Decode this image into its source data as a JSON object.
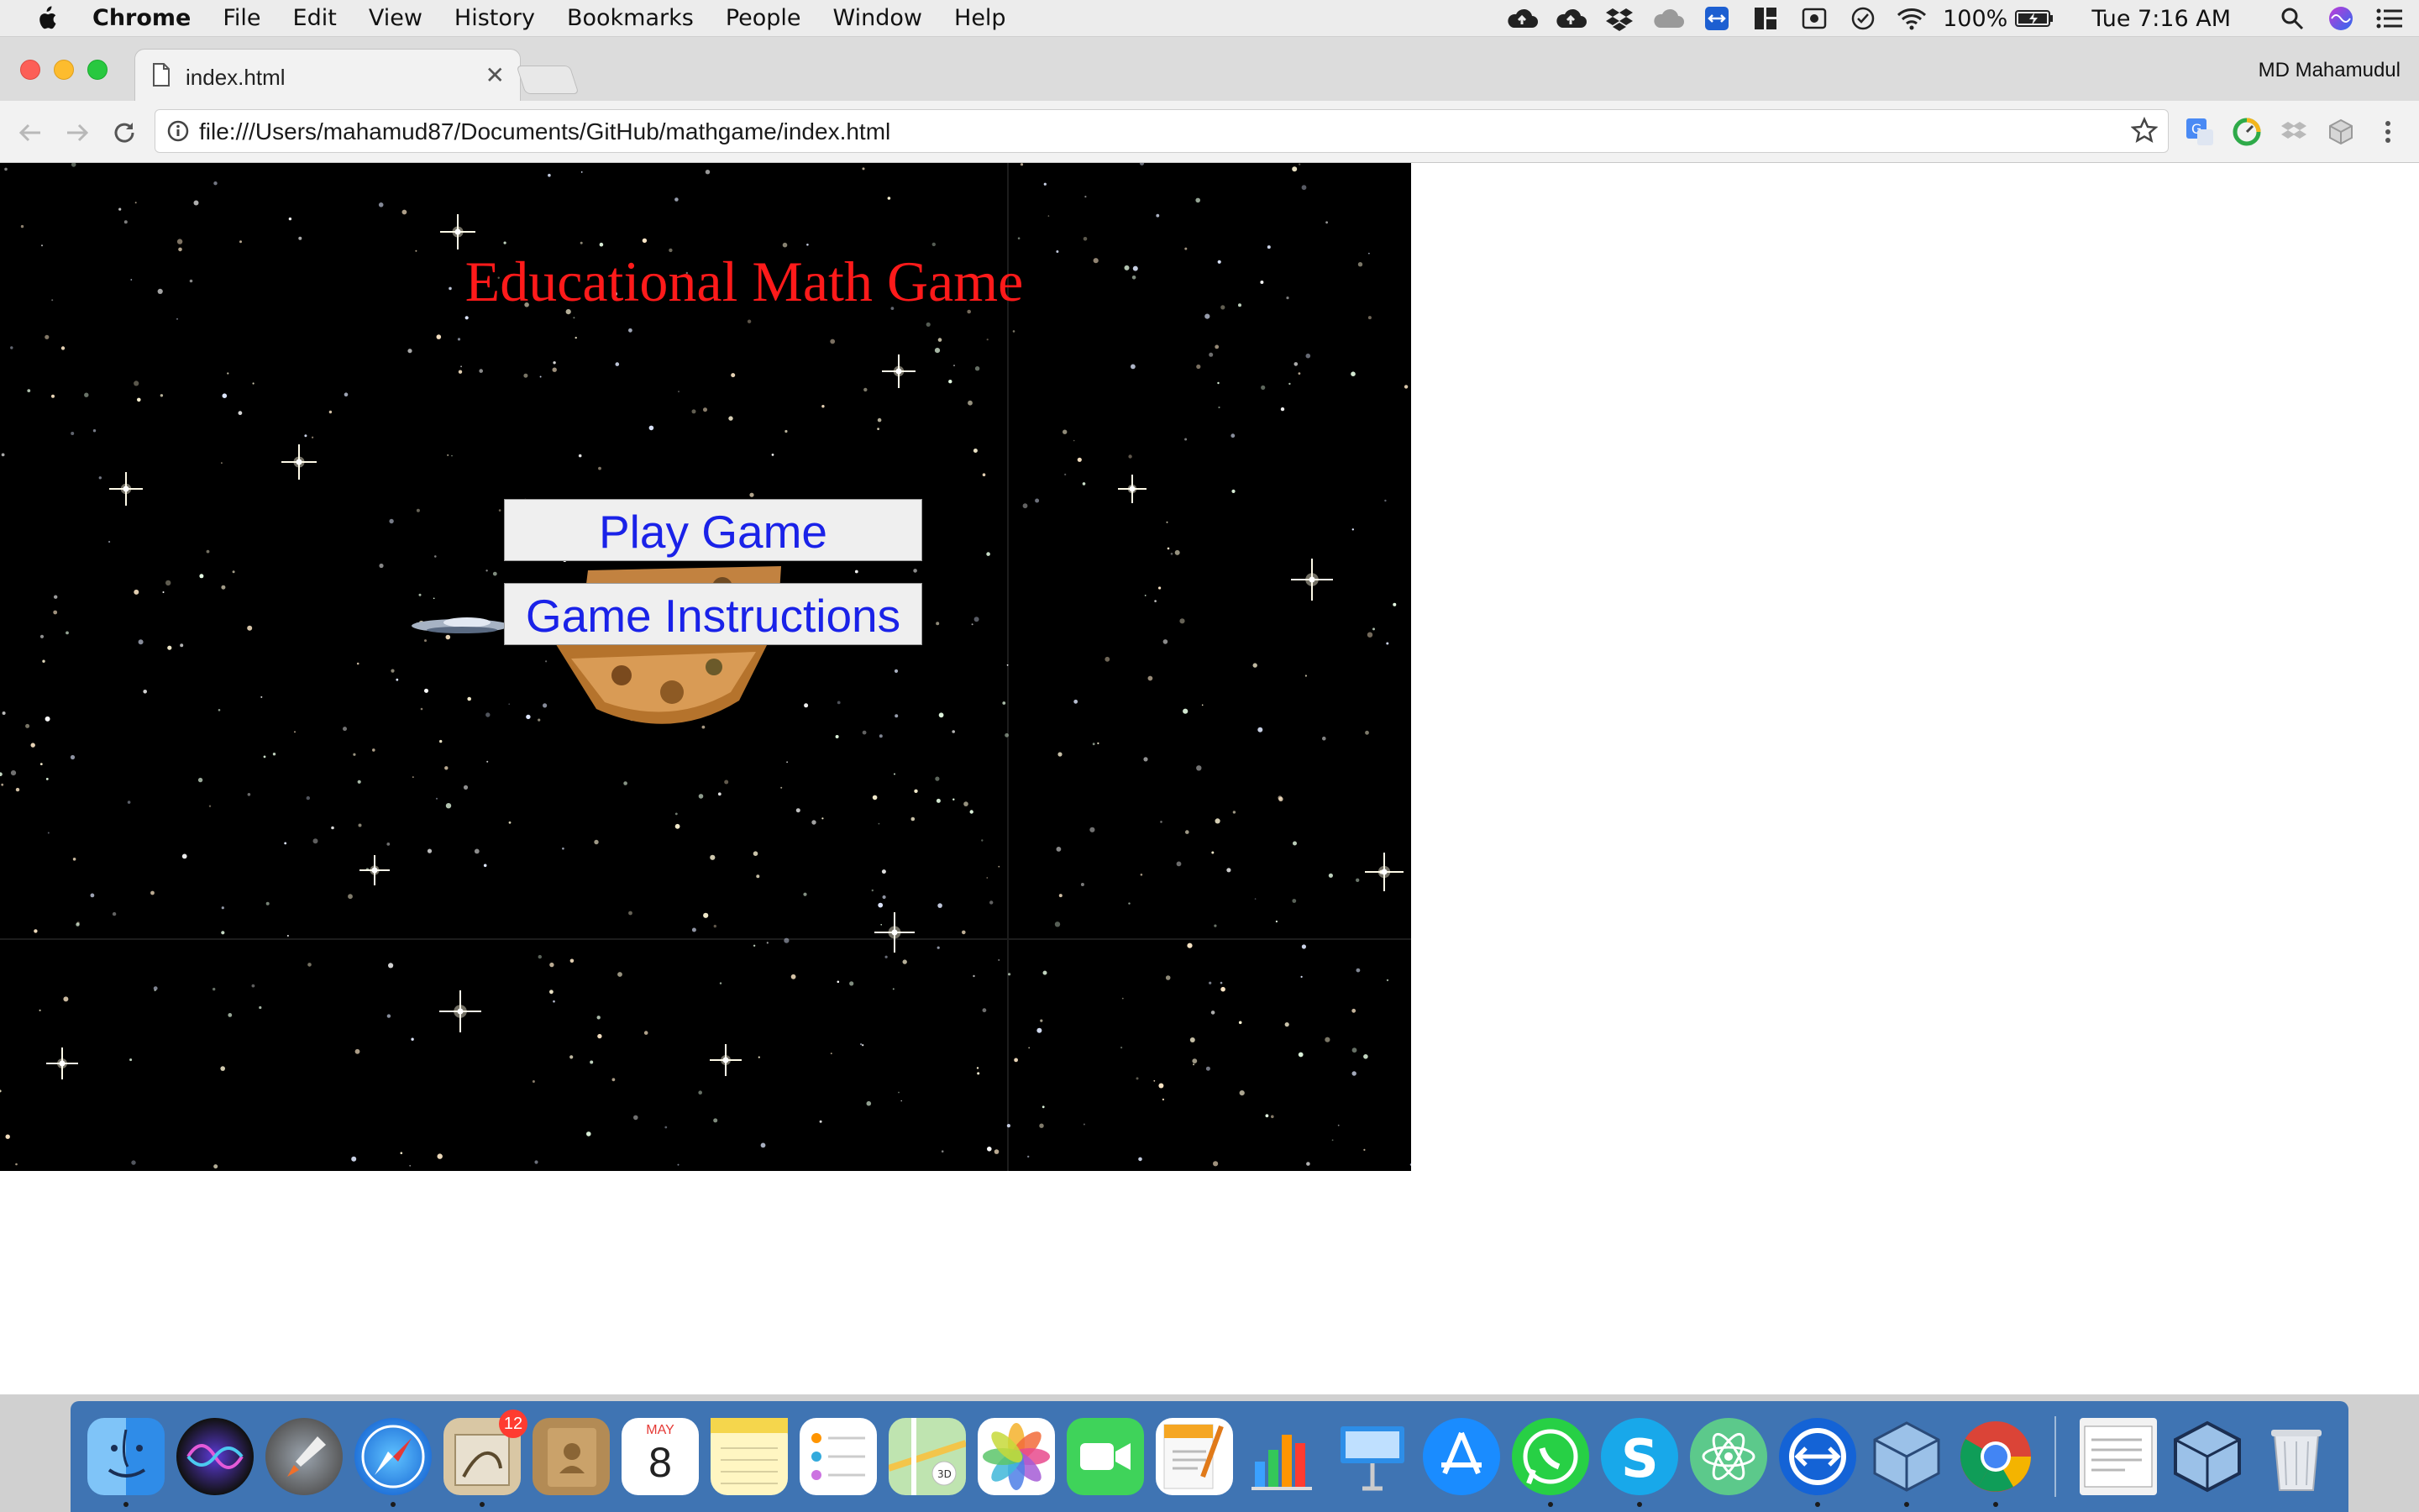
{
  "menubar": {
    "app_name": "Chrome",
    "items": [
      "File",
      "Edit",
      "View",
      "History",
      "Bookmarks",
      "People",
      "Window",
      "Help"
    ],
    "battery": "100%",
    "clock": "Tue 7:16 AM"
  },
  "browser": {
    "tab_title": "index.html",
    "profile_name": "MD Mahamudul",
    "url": "file:///Users/mahamud87/Documents/GitHub/mathgame/index.html"
  },
  "page": {
    "title": "Educational Math Game",
    "play_button": "Play Game",
    "instructions_button": "Game Instructions"
  },
  "dock": {
    "calendar_month": "MAY",
    "calendar_day": "8",
    "mail_badge": "12",
    "apps": [
      "Finder",
      "Siri",
      "Launchpad",
      "Safari",
      "Mail",
      "Contacts",
      "Calendar",
      "Notes",
      "Reminders",
      "Maps",
      "Photos",
      "FaceTime",
      "Pages",
      "Numbers",
      "Keynote",
      "App Store",
      "WhatsApp",
      "Skype",
      "Atom",
      "TeamViewer",
      "VirtualBox",
      "Chrome",
      "Documents",
      "VirtualBox",
      "Trash"
    ]
  },
  "colors": {
    "title_red": "#ff1a1a",
    "button_text_blue": "#1a22e8",
    "dock_blue": "#3f74b3"
  }
}
